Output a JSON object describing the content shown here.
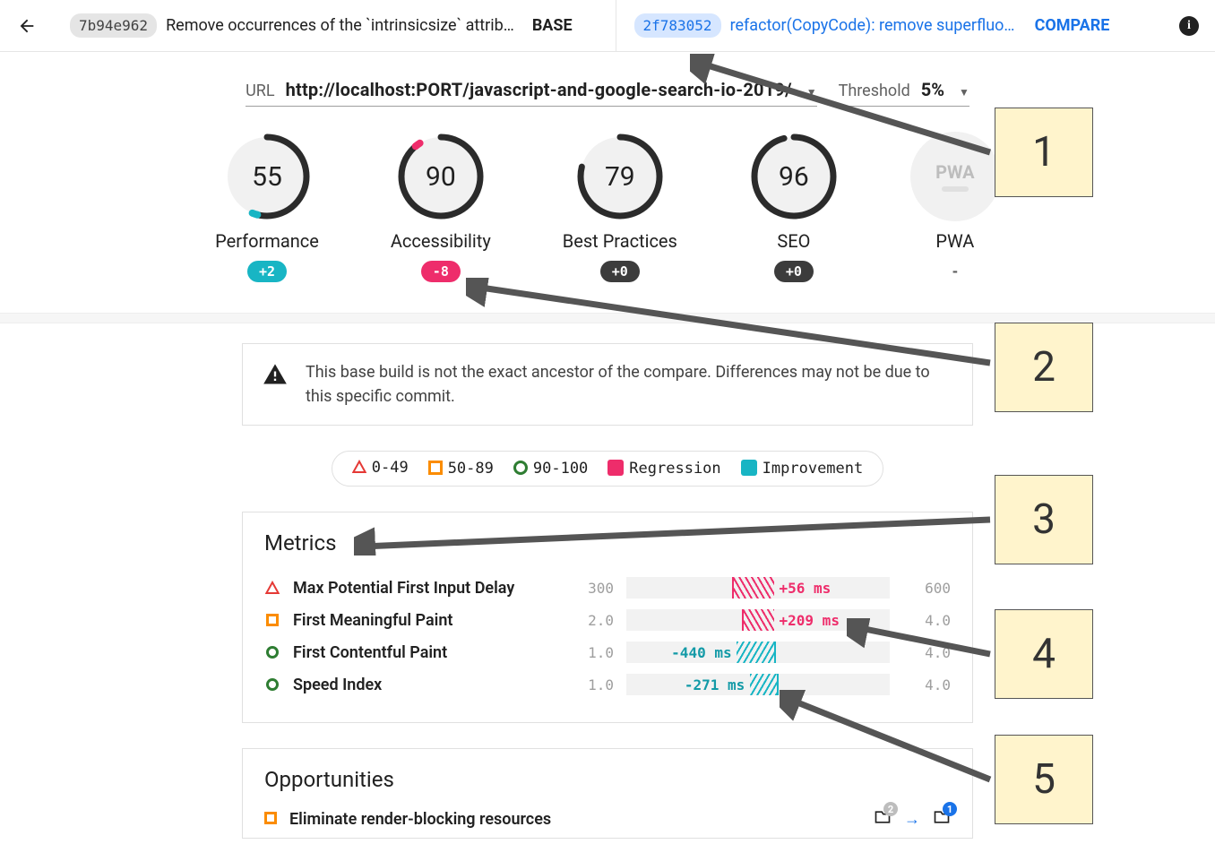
{
  "header": {
    "base": {
      "hash": "7b94e962",
      "message": "Remove occurrences of the `intrinsicsize` attrib…",
      "role": "BASE"
    },
    "compare": {
      "hash": "2f783052",
      "message": "refactor(CopyCode): remove superfluous a…",
      "role": "COMPARE"
    }
  },
  "controls": {
    "url_label": "URL",
    "url_value": "http://localhost:PORT/javascript-and-google-search-io-2019/",
    "threshold_label": "Threshold",
    "threshold_value": "5%"
  },
  "gauges": [
    {
      "label": "Performance",
      "score": "55",
      "pct": 55,
      "delta": "+2",
      "pill": "teal",
      "marker": "teal"
    },
    {
      "label": "Accessibility",
      "score": "90",
      "pct": 90,
      "delta": "-8",
      "pill": "pink",
      "marker": "pink"
    },
    {
      "label": "Best Practices",
      "score": "79",
      "pct": 79,
      "delta": "+0",
      "pill": "dark"
    },
    {
      "label": "SEO",
      "score": "96",
      "pct": 96,
      "delta": "+0",
      "pill": "dark"
    },
    {
      "label": "PWA",
      "pwa": true,
      "delta": "-",
      "pill": "none"
    }
  ],
  "warning": "This base build is not the exact ancestor of the compare. Differences may not be due to this specific commit.",
  "legend": {
    "r0": "0-49",
    "r1": "50-89",
    "r2": "90-100",
    "reg": "Regression",
    "imp": "Improvement"
  },
  "metrics_title": "Metrics",
  "metrics": [
    {
      "shape": "tri-red",
      "name": "Max Potential First Input Delay",
      "min": "300",
      "max": "600",
      "delta": "+56 ms",
      "dir": "pink",
      "hatch_l": 40,
      "hatch_w": 16,
      "label_side": "right"
    },
    {
      "shape": "sq-orange",
      "name": "First Meaningful Paint",
      "min": "2.0",
      "max": "4.0",
      "delta": "+209 ms",
      "dir": "pink",
      "hatch_l": 44,
      "hatch_w": 12,
      "label_side": "right"
    },
    {
      "shape": "circ-green",
      "name": "First Contentful Paint",
      "min": "1.0",
      "max": "4.0",
      "delta": "-440 ms",
      "dir": "teal",
      "hatch_l": 42,
      "hatch_w": 14,
      "label_side": "left"
    },
    {
      "shape": "circ-green",
      "name": "Speed Index",
      "min": "1.0",
      "max": "4.0",
      "delta": "-271 ms",
      "dir": "teal",
      "hatch_l": 47,
      "hatch_w": 10,
      "label_side": "left"
    }
  ],
  "opportunities_title": "Opportunities",
  "opportunities": [
    {
      "shape": "sq-orange",
      "name": "Eliminate render-blocking resources",
      "base_badge": "2",
      "compare_badge": "1"
    }
  ],
  "callouts": [
    "1",
    "2",
    "3",
    "4",
    "5"
  ],
  "pwa_text": "PWA"
}
